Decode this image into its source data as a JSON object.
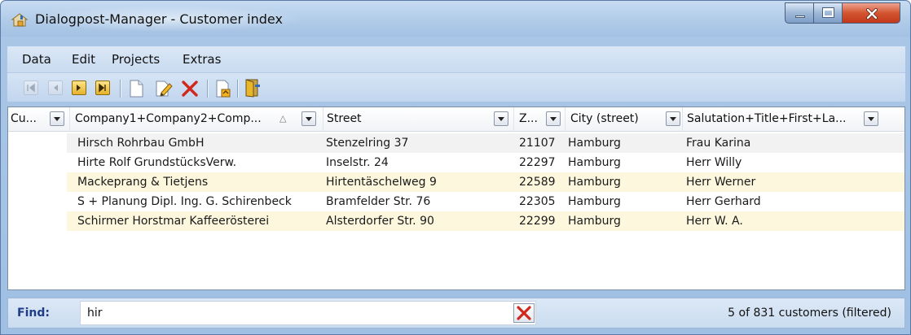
{
  "window": {
    "title": "Dialogpost-Manager - Customer index",
    "controls": {
      "minimize": "minimize",
      "maximize": "maximize",
      "close": "close"
    }
  },
  "menu": {
    "items": [
      "Data",
      "Edit",
      "Projects",
      "Extras"
    ]
  },
  "toolbar": {
    "icons": [
      "first-record-icon",
      "previous-record-icon",
      "next-record-icon",
      "last-record-icon",
      "new-document-icon",
      "edit-icon",
      "delete-icon",
      "export-icon",
      "exit-icon"
    ]
  },
  "table": {
    "columns": [
      {
        "label": "Cu..."
      },
      {
        "label": "Company1+Company2+Comp...",
        "sort": "△"
      },
      {
        "label": "Street"
      },
      {
        "label": "Z..."
      },
      {
        "label": "City (street)"
      },
      {
        "label": "Salutation+Title+First+La..."
      }
    ],
    "rows": [
      {
        "customer": "",
        "company": "Hirsch Rohrbau GmbH",
        "street": "Stenzelring 37",
        "zip": "21107",
        "city": "Hamburg",
        "salutation": "Frau Karina"
      },
      {
        "customer": "",
        "company": "Hirte Rolf GrundstücksVerw.",
        "street": "Inselstr. 24",
        "zip": "22297",
        "city": "Hamburg",
        "salutation": "Herr Willy"
      },
      {
        "customer": "",
        "company": "Mackeprang & Tietjens",
        "street": "Hirtentäschelweg 9",
        "zip": "22589",
        "city": "Hamburg",
        "salutation": "Herr Werner"
      },
      {
        "customer": "",
        "company": "S + Planung Dipl. Ing. G. Schirenbeck",
        "street": "Bramfelder Str. 76",
        "zip": "22305",
        "city": "Hamburg",
        "salutation": "Herr Gerhard"
      },
      {
        "customer": "",
        "company": "Schirmer Horstmar Kaffeerösterei",
        "street": "Alsterdorfer Str. 90",
        "zip": "22299",
        "city": "Hamburg",
        "salutation": "Herr W. A."
      }
    ]
  },
  "find": {
    "label": "Find:",
    "value": "hir",
    "status": "5 of 831 customers (filtered)"
  },
  "colors": {
    "row_odd": "#f2f2f2",
    "row_even": "#fdf7dd",
    "find_label": "#1f3c86",
    "delete_red": "#d0281c"
  }
}
